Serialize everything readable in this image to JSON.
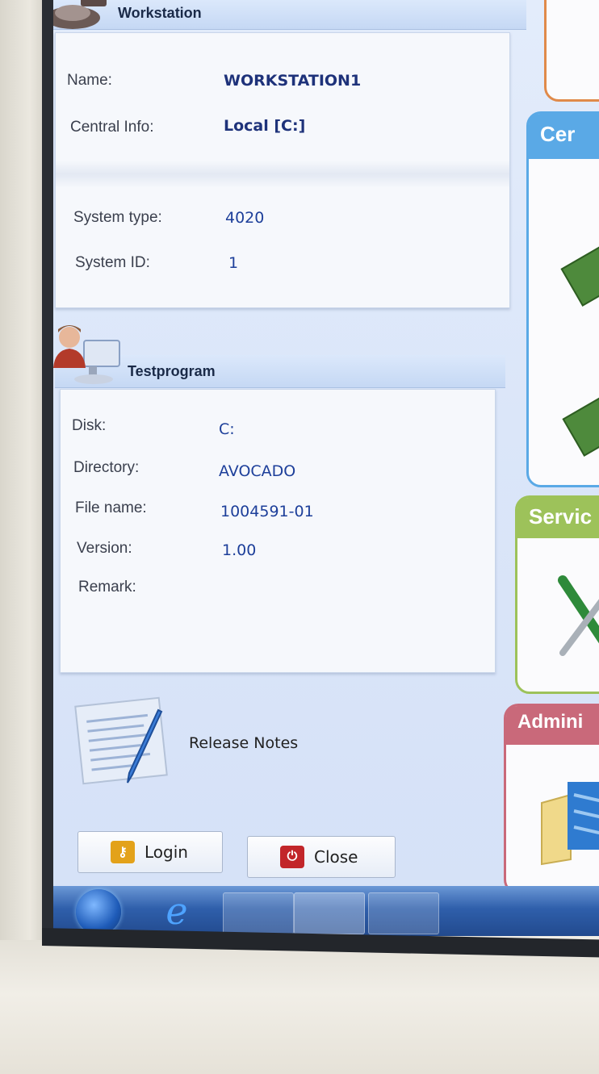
{
  "workstation": {
    "title": "Workstation",
    "fields": [
      {
        "label": "Name:",
        "value": "WORKSTATION1"
      },
      {
        "label": "Central Info:",
        "value": "Local [C:]"
      },
      {
        "label": "System type:",
        "value": "4020"
      },
      {
        "label": "System ID:",
        "value": "1"
      }
    ]
  },
  "testprogram": {
    "title": "Testprogram",
    "fields": [
      {
        "label": "Disk:",
        "value": "C:"
      },
      {
        "label": "Directory:",
        "value": "AVOCADO"
      },
      {
        "label": "File name:",
        "value": "1004591-01"
      },
      {
        "label": "Version:",
        "value": "1.00"
      },
      {
        "label": "Remark:",
        "value": ""
      }
    ]
  },
  "release_notes": {
    "label": "Release Notes"
  },
  "buttons": {
    "login": "Login",
    "close": "Close"
  },
  "side_tiles": [
    {
      "title": "Cer",
      "color": "#5aa9e6"
    },
    {
      "title": "Servic",
      "color": "#9dc25a"
    },
    {
      "title": "Admini",
      "color": "#c9697a"
    }
  ],
  "taskbar": {
    "items": [
      "start-orb",
      "internet-explorer-icon",
      "printer-app",
      "document-app",
      "image-app"
    ]
  },
  "colors": {
    "value_text": "#1d3f9a",
    "taskbar": "#2f5fab",
    "login_icon": "#e3a21a",
    "close_icon": "#c2262a"
  }
}
